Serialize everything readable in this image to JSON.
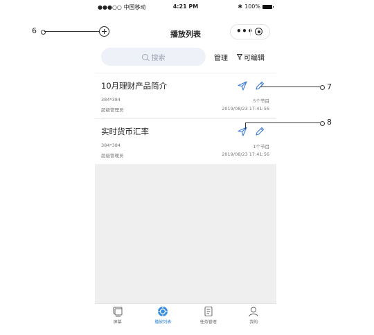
{
  "status_bar": {
    "carrier": "●●●○○ 中国移动 ",
    "time": "4:21 PM",
    "battery": "100%"
  },
  "nav": {
    "title": "播放列表"
  },
  "toolbar": {
    "search_placeholder": "搜索",
    "manage_label": "管理",
    "editable_label": "可编辑"
  },
  "playlists": [
    {
      "title": "10月理财产品简介",
      "size": "384*384",
      "count": "5个节目",
      "owner": "超级管理员",
      "date": "2019/08/23 17:41:56"
    },
    {
      "title": "实时货币汇率",
      "size": "384*384",
      "count": "1个节目",
      "owner": "超级管理员",
      "date": "2019/08/23 17:41:56"
    }
  ],
  "tabs": [
    {
      "label": "屏幕",
      "icon": "screen-icon"
    },
    {
      "label": "播放列表",
      "icon": "playlist-icon"
    },
    {
      "label": "任务管理",
      "icon": "task-icon"
    },
    {
      "label": "我的",
      "icon": "profile-icon"
    }
  ],
  "callouts": {
    "c6": "6",
    "c7": "7",
    "c8": "8"
  },
  "colors": {
    "accent": "#2a7fd4",
    "icon_blue": "#3a7bd5",
    "search_bg": "#eef1f7"
  }
}
